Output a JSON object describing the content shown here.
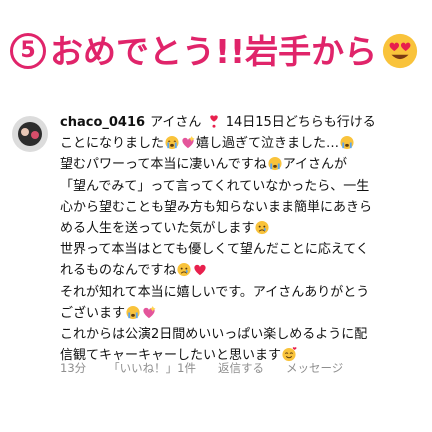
{
  "header": {
    "number": "5",
    "title": "おめでとう!!岩手から",
    "emoji": "heart-eyes-emoji"
  },
  "comment": {
    "username": "chaco_0416",
    "lines": [
      "アイさん",
      "14日15日どちらも行ける",
      "ことになりました",
      "嬉し過ぎて泣きました…",
      "望むパワーって本当に凄いんですね",
      "アイさんが",
      "「望んでみて」って言ってくれていなかったら、一生",
      "心から望むことも望み方も知らないまま簡単にあきら",
      "める人生を送っていた気がします",
      "世界って本当はとても優しくて望んだことに応えてく",
      "れるものなんですね",
      "それが知れて本当に嬉しいです。アイさんありがとう",
      "ございます",
      "これからは公演2日間めいいっぱい楽しめるように配",
      "信観てキャーキャーしたいと思います"
    ],
    "icons": [
      "heart-exclamation-icon",
      "crying-face-icon",
      "sparkling-heart-icon",
      "sad-face-icon",
      "red-heart-icon",
      "smiling-hearts-face-icon"
    ]
  },
  "meta": {
    "time": "13分",
    "likes": "「いいね！」1件",
    "reply": "返信する",
    "message": "メッセージ"
  }
}
